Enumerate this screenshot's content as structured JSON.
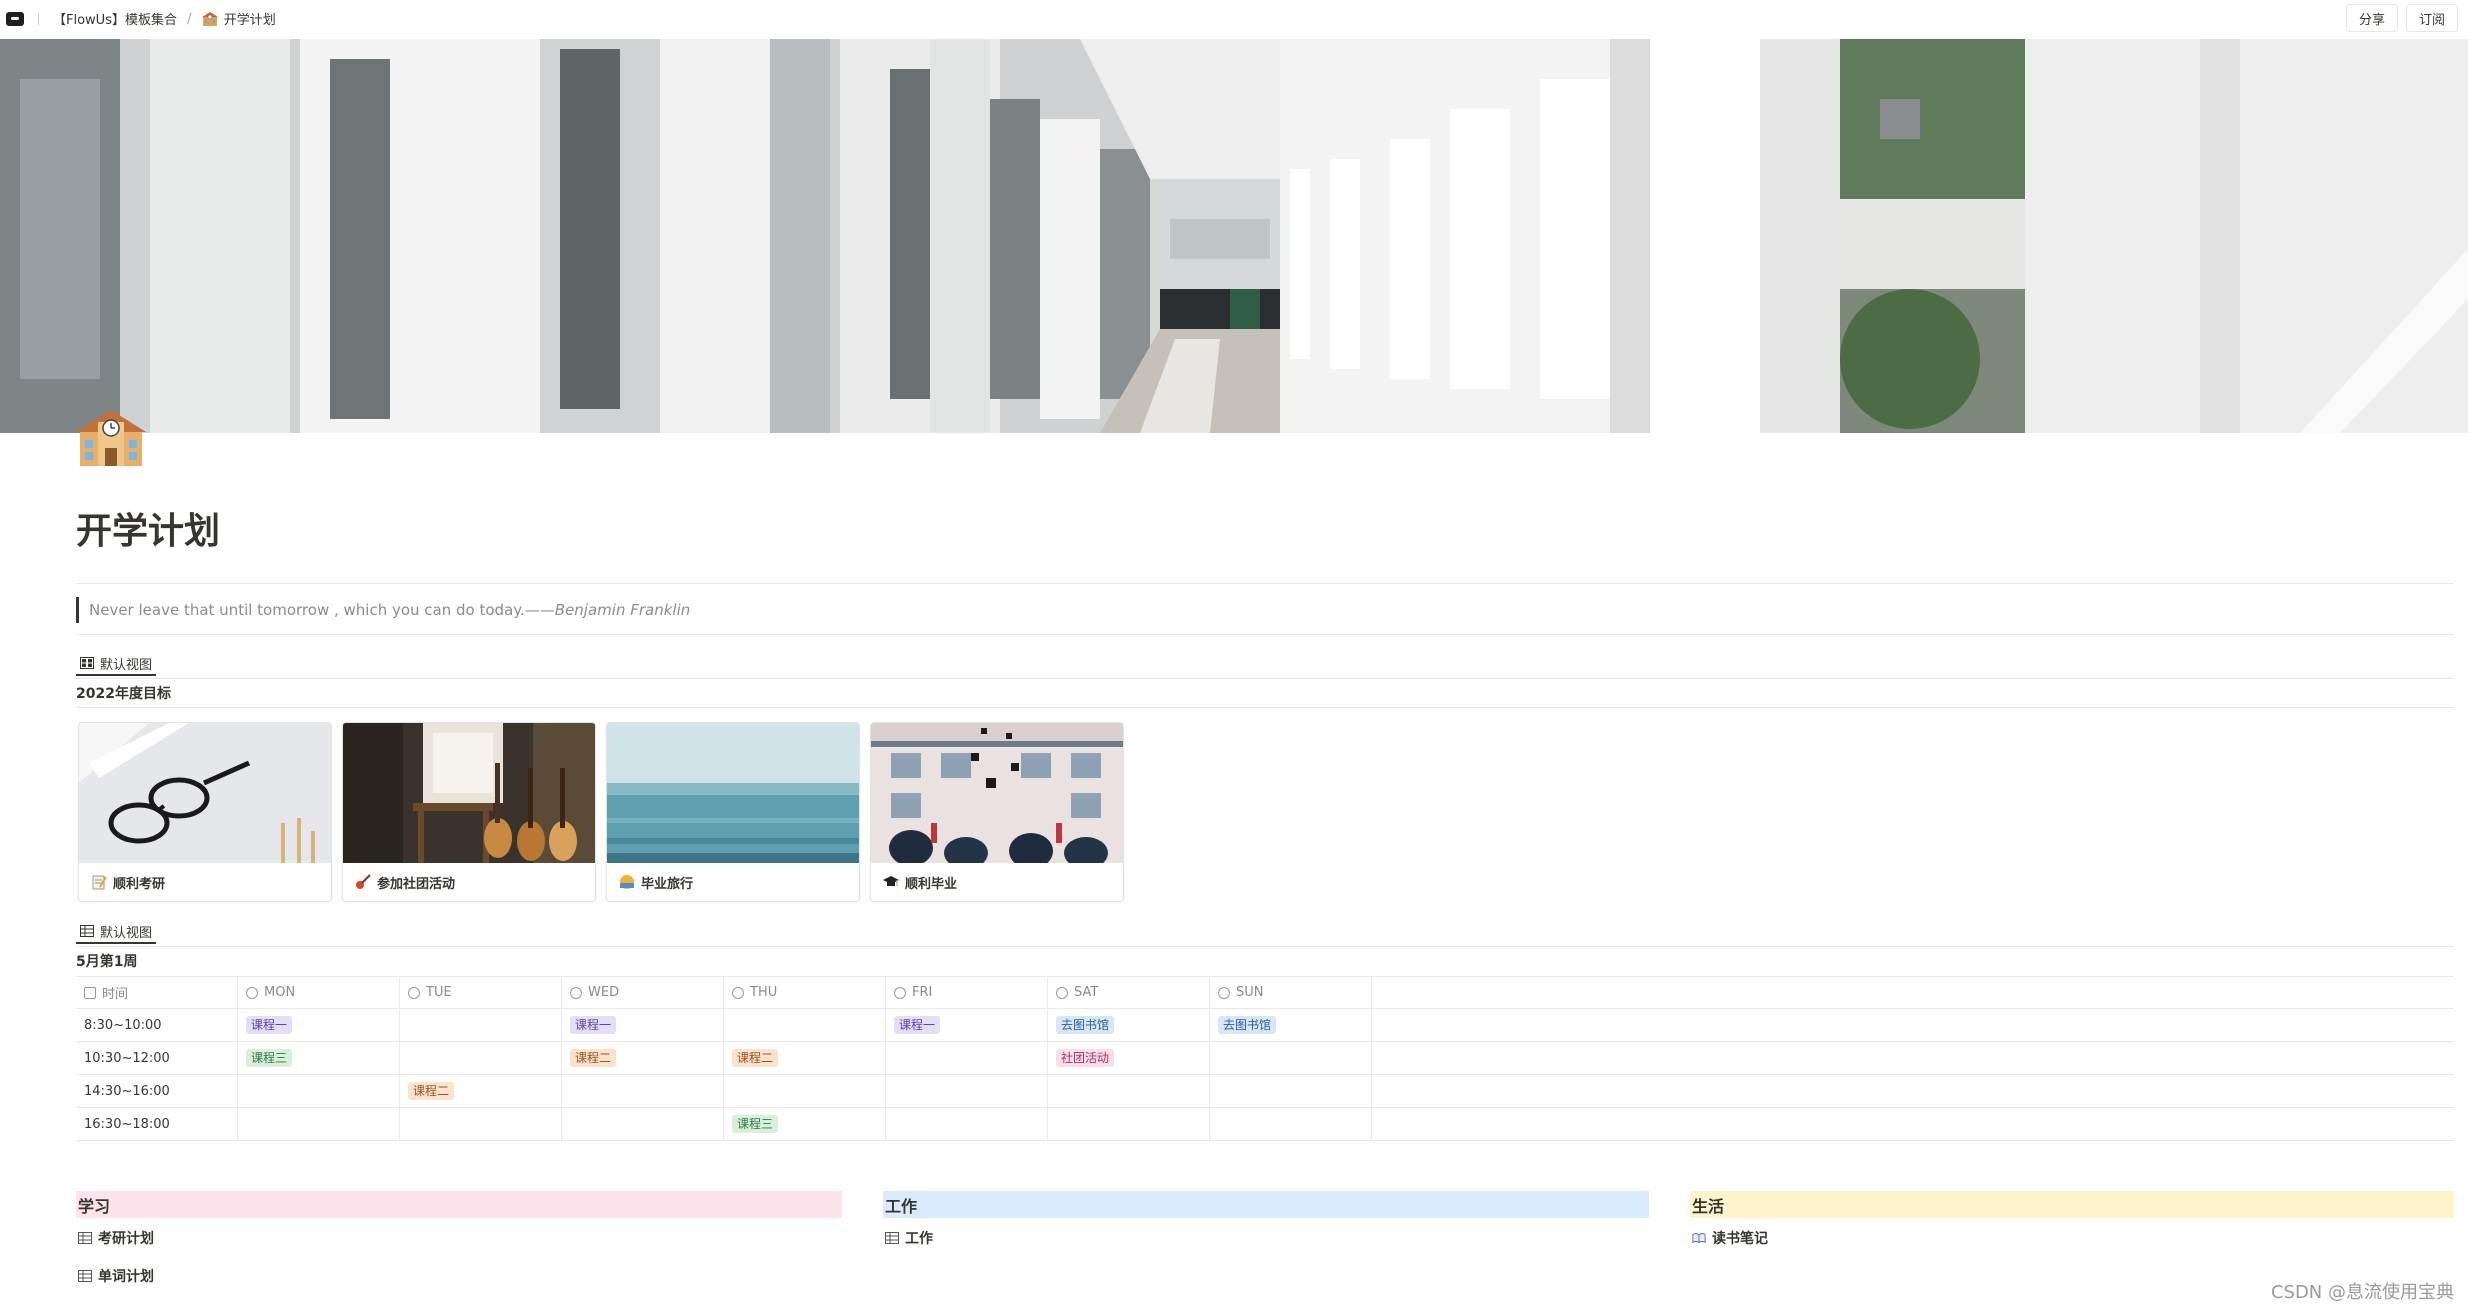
{
  "topbar": {
    "workspace": "【FlowUs】模板集合",
    "page": "开学计划",
    "share_label": "分享",
    "subscribe_label": "订阅"
  },
  "page": {
    "title": "开学计划",
    "icon": "school-icon"
  },
  "quote": {
    "text": "Never leave that until tomorrow , which you can do today.——",
    "author": "Benjamin Franklin"
  },
  "gallery": {
    "view_label": "默认视图",
    "title": "2022年度目标",
    "cards": [
      {
        "label": "顺利考研",
        "icon": "memo-icon"
      },
      {
        "label": "参加社团活动",
        "icon": "guitar-icon"
      },
      {
        "label": "毕业旅行",
        "icon": "sunrise-icon"
      },
      {
        "label": "顺利毕业",
        "icon": "graduation-cap-icon"
      }
    ]
  },
  "schedule": {
    "view_label": "默认视图",
    "title": "5月第1周",
    "columns": [
      "时间",
      "MON",
      "TUE",
      "WED",
      "THU",
      "FRI",
      "SAT",
      "SUN"
    ],
    "rows": [
      {
        "time": "8:30~10:00",
        "cells": [
          "课程一",
          "",
          "课程一",
          "",
          "课程一",
          "去图书馆",
          "去图书馆"
        ]
      },
      {
        "time": "10:30~12:00",
        "cells": [
          "课程三",
          "",
          "课程二",
          "课程二",
          "",
          "社团活动",
          ""
        ]
      },
      {
        "time": "14:30~16:00",
        "cells": [
          "",
          "课程二",
          "",
          "",
          "",
          "",
          ""
        ]
      },
      {
        "time": "16:30~18:00",
        "cells": [
          "",
          "",
          "",
          "课程三",
          "",
          "",
          ""
        ]
      }
    ],
    "tag_colors": {
      "课程一": {
        "bg": "#e4def7",
        "fg": "#5a43a8"
      },
      "课程二": {
        "bg": "#fbe2cc",
        "fg": "#9a5420"
      },
      "课程三": {
        "bg": "#d9efdc",
        "fg": "#2f7a3e"
      },
      "去图书馆": {
        "bg": "#d8e7f7",
        "fg": "#2b5e95"
      },
      "社团活动": {
        "bg": "#f9dde9",
        "fg": "#a63466"
      }
    }
  },
  "sections": {
    "study": {
      "title": "学习",
      "color": "#fde4ec",
      "links": [
        "考研计划",
        "单词计划"
      ]
    },
    "work": {
      "title": "工作",
      "color": "#dbeafc",
      "links": [
        "工作"
      ]
    },
    "life": {
      "title": "生活",
      "color": "#fdf4cc",
      "links": [
        "读书笔记"
      ]
    }
  },
  "watermark": "CSDN @息流使用宝典"
}
